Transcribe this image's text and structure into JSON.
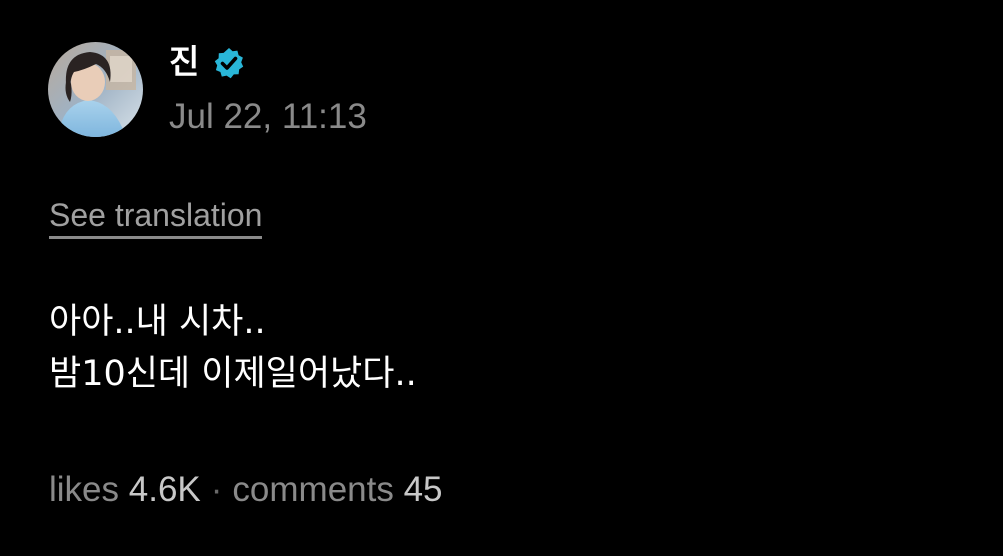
{
  "author": {
    "name": "진",
    "verified": true,
    "avatar_icon": "profile-photo",
    "verified_icon": "verified-badge-icon",
    "verified_color": "#29b6d8"
  },
  "post": {
    "timestamp": "Jul 22, 11:13",
    "see_translation": "See translation",
    "lines": [
      "아아..내 시차..",
      "밤10신데 이제일어났다.."
    ]
  },
  "stats": {
    "likes_label": "likes",
    "likes_value": "4.6K",
    "separator": "·",
    "comments_label": "comments",
    "comments_value": "45"
  },
  "colors": {
    "background": "#000000",
    "text": "#ffffff",
    "muted": "#8a8a8a"
  }
}
